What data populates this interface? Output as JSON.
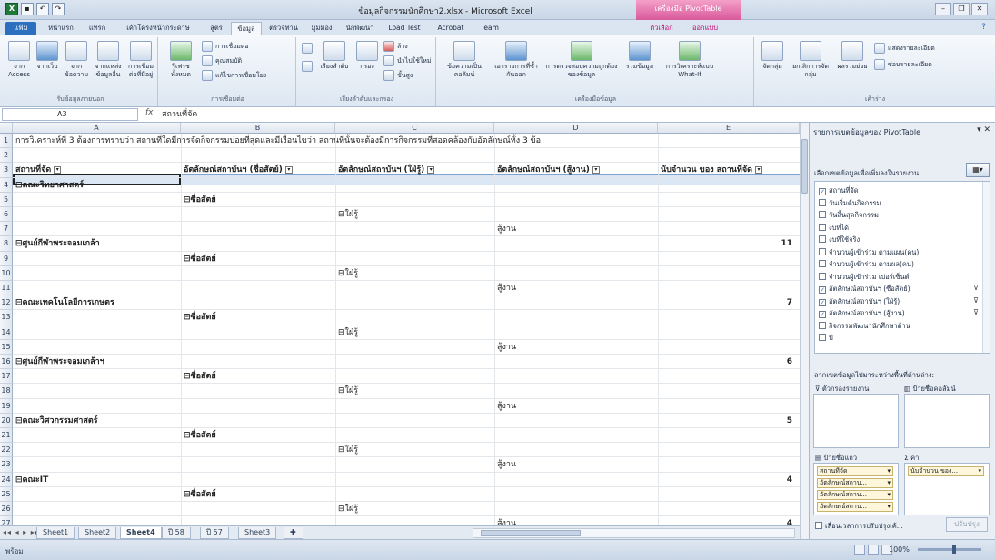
{
  "window": {
    "title": "ข้อมูลกิจกรรมนักศึกษา2.xlsx - Microsoft Excel",
    "context_tab": "เครื่องมือ PivotTable"
  },
  "ribbon_tabs": [
    "แฟ้ม",
    "หน้าแรก",
    "แทรก",
    "เค้าโครงหน้ากระดาษ",
    "สูตร",
    "ข้อมูล",
    "ตรวจทาน",
    "มุมมอง",
    "นักพัฒนา",
    "Load Test",
    "Acrobat",
    "Team",
    "ตัวเลือก",
    "ออกแบบ"
  ],
  "active_tab": "ข้อมูล",
  "ribbon": {
    "g1": {
      "label": "รับข้อมูลภายนอก",
      "b1": "จาก Access",
      "b2": "จากเว็บ",
      "b3": "จากข้อความ",
      "b4": "จากแหล่งข้อมูลอื่น",
      "b5": "การเชื่อมต่อที่มีอยู่"
    },
    "g2": {
      "label": "การเชื่อมต่อ",
      "b1": "รีเฟรชทั้งหมด",
      "s1": "การเชื่อมต่อ",
      "s2": "คุณสมบัติ",
      "s3": "แก้ไขการเชื่อมโยง"
    },
    "g3": {
      "label": "เรียงลำดับและกรอง",
      "b1": "เรียงลำดับ",
      "b2": "กรอง",
      "s1": "ล้าง",
      "s2": "นำไปใช้ใหม่",
      "s3": "ขั้นสูง"
    },
    "g4": {
      "label": "เครื่องมือข้อมูล",
      "b1": "ข้อความเป็นคอลัมน์",
      "b2": "เอารายการที่ซ้ำกันออก",
      "b3": "การตรวจสอบความถูกต้องของข้อมูล",
      "b4": "รวมข้อมูล",
      "b5": "การวิเคราะห์แบบ What-If"
    },
    "g5": {
      "label": "เค้าร่าง",
      "b1": "จัดกลุ่ม",
      "b2": "ยกเลิกการจัดกลุ่ม",
      "b3": "ผลรวมย่อย",
      "s1": "แสดงรายละเอียด",
      "s2": "ซ่อนรายละเอียด"
    }
  },
  "formula_bar": {
    "name_box": "A3",
    "fx": "fx",
    "value": "สถานที่จัด"
  },
  "columns": [
    "A",
    "B",
    "C",
    "D",
    "E"
  ],
  "rows": [
    {
      "n": "1",
      "a": "การวิเคราะห์ที่ 3 ต้องการทราบว่า  สถานที่ใดมีการจัดกิจกรรมบ่อยที่สุดและมีเงื่อนไขว่า  สถานที่นั้นจะต้องมีการกิจกรรมที่สอดคล้องกับอัตลักษณ์ทั้ง  3 ข้อ",
      "b": "",
      "c": "",
      "d": "",
      "e": ""
    },
    {
      "n": "2",
      "a": "",
      "b": "",
      "c": "",
      "d": "",
      "e": ""
    },
    {
      "n": "3",
      "a": "สถานที่จัด",
      "b": "อัตลักษณ์สถาบันฯ (ซื่อสัตย์)",
      "c": "อัตลักษณ์สถาบันฯ (ใฝ่รู้)",
      "d": "อัตลักษณ์สถาบันฯ (สู้งาน)",
      "e": "นับจำนวน ของ สถานที่จัด"
    },
    {
      "n": "4",
      "a": "⊟คณะวิทยาศาสตร์",
      "b": "",
      "c": "",
      "d": "",
      "e": ""
    },
    {
      "n": "5",
      "a": "",
      "b": "⊟ซื่อสัตย์",
      "c": "",
      "d": "",
      "e": ""
    },
    {
      "n": "6",
      "a": "",
      "b": "",
      "c": "⊟ใฝ่รู้",
      "d": "",
      "e": ""
    },
    {
      "n": "7",
      "a": "",
      "b": "",
      "c": "",
      "d": "สู้งาน",
      "e": ""
    },
    {
      "n": "8",
      "a": "⊟ศูนย์กีฬาพระจอมเกล้า",
      "b": "",
      "c": "",
      "d": "",
      "e": "11"
    },
    {
      "n": "9",
      "a": "",
      "b": "⊟ซื่อสัตย์",
      "c": "",
      "d": "",
      "e": ""
    },
    {
      "n": "10",
      "a": "",
      "b": "",
      "c": "⊟ใฝ่รู้",
      "d": "",
      "e": ""
    },
    {
      "n": "11",
      "a": "",
      "b": "",
      "c": "",
      "d": "สู้งาน",
      "e": ""
    },
    {
      "n": "12",
      "a": "⊟คณะเทคโนโลยีการเกษตร",
      "b": "",
      "c": "",
      "d": "",
      "e": "7"
    },
    {
      "n": "13",
      "a": "",
      "b": "⊟ซื่อสัตย์",
      "c": "",
      "d": "",
      "e": ""
    },
    {
      "n": "14",
      "a": "",
      "b": "",
      "c": "⊟ใฝ่รู้",
      "d": "",
      "e": ""
    },
    {
      "n": "15",
      "a": "",
      "b": "",
      "c": "",
      "d": "สู้งาน",
      "e": ""
    },
    {
      "n": "16",
      "a": "⊟ศูนย์กีฬาพระจอมเกล้าฯ",
      "b": "",
      "c": "",
      "d": "",
      "e": "6"
    },
    {
      "n": "17",
      "a": "",
      "b": "⊟ซื่อสัตย์",
      "c": "",
      "d": "",
      "e": ""
    },
    {
      "n": "18",
      "a": "",
      "b": "",
      "c": "⊟ใฝ่รู้",
      "d": "",
      "e": ""
    },
    {
      "n": "19",
      "a": "",
      "b": "",
      "c": "",
      "d": "สู้งาน",
      "e": ""
    },
    {
      "n": "20",
      "a": "⊟คณะวิศวกรรมศาสตร์",
      "b": "",
      "c": "",
      "d": "",
      "e": "5"
    },
    {
      "n": "21",
      "a": "",
      "b": "⊟ซื่อสัตย์",
      "c": "",
      "d": "",
      "e": ""
    },
    {
      "n": "22",
      "a": "",
      "b": "",
      "c": "⊟ใฝ่รู้",
      "d": "",
      "e": ""
    },
    {
      "n": "23",
      "a": "",
      "b": "",
      "c": "",
      "d": "สู้งาน",
      "e": ""
    },
    {
      "n": "24",
      "a": "⊟คณะIT",
      "b": "",
      "c": "",
      "d": "",
      "e": "4"
    },
    {
      "n": "25",
      "a": "",
      "b": "⊟ซื่อสัตย์",
      "c": "",
      "d": "",
      "e": ""
    },
    {
      "n": "26",
      "a": "",
      "b": "",
      "c": "⊟ใฝ่รู้",
      "d": "",
      "e": ""
    },
    {
      "n": "27",
      "a": "",
      "b": "",
      "c": "",
      "d": "สู้งาน",
      "e": "4"
    }
  ],
  "sheet_tabs": [
    "Sheet1",
    "Sheet2",
    "Sheet4",
    "ปี 58",
    "ปี 57",
    "Sheet3"
  ],
  "active_sheet": "Sheet4",
  "status": {
    "ready": "พร้อม",
    "zoom": "100%"
  },
  "pivot_pane": {
    "title": "รายการเขตข้อมูลของ PivotTable",
    "hint": "เลือกเขตข้อมูลเพื่อเพิ่มลงในรายงาน:",
    "fields": [
      {
        "label": "สถานที่จัด",
        "checked": true,
        "filtered": false
      },
      {
        "label": "วันเริ่มต้นกิจกรรม",
        "checked": false,
        "filtered": false
      },
      {
        "label": "วันสิ้นสุดกิจกรรม",
        "checked": false,
        "filtered": false
      },
      {
        "label": "งบที่ได้",
        "checked": false,
        "filtered": false
      },
      {
        "label": "งบที่ใช้จริง",
        "checked": false,
        "filtered": false
      },
      {
        "label": "จำนวนผู้เข้าร่วม ตามแผน(คน)",
        "checked": false,
        "filtered": false
      },
      {
        "label": "จำนวนผู้เข้าร่วม ตามผล(คน)",
        "checked": false,
        "filtered": false
      },
      {
        "label": "จำนวนผู้เข้าร่วม เปอร์เซ็นต์",
        "checked": false,
        "filtered": false
      },
      {
        "label": "อัตลักษณ์สถาบันฯ (ซื่อสัตย์)",
        "checked": true,
        "filtered": true
      },
      {
        "label": "อัตลักษณ์สถาบันฯ (ใฝ่รู้)",
        "checked": true,
        "filtered": true
      },
      {
        "label": "อัตลักษณ์สถาบันฯ (สู้งาน)",
        "checked": true,
        "filtered": true
      },
      {
        "label": "กิจกรรมพัฒนานักศึกษาด้าน",
        "checked": false,
        "filtered": false
      },
      {
        "label": "ปี",
        "checked": false,
        "filtered": false
      }
    ],
    "area_hint": "ลากเขตข้อมูลไปมาระหว่างพื้นที่ด้านล่าง:",
    "zones": {
      "filter": "ตัวกรองรายงาน",
      "cols": "ป้ายชื่อคอลัมน์",
      "rows": "ป้ายชื่อแถว",
      "values": "ค่า"
    },
    "row_chips": [
      "สถานที่จัด",
      "อัตลักษณ์สถาบ...",
      "อัตลักษณ์สถาบ...",
      "อัตลักษณ์สถาบ..."
    ],
    "value_chips": [
      "นับจำนวน ของ..."
    ],
    "defer": "เลื่อนเวลาการปรับปรุงเค้...",
    "update": "ปรับปรุง"
  }
}
